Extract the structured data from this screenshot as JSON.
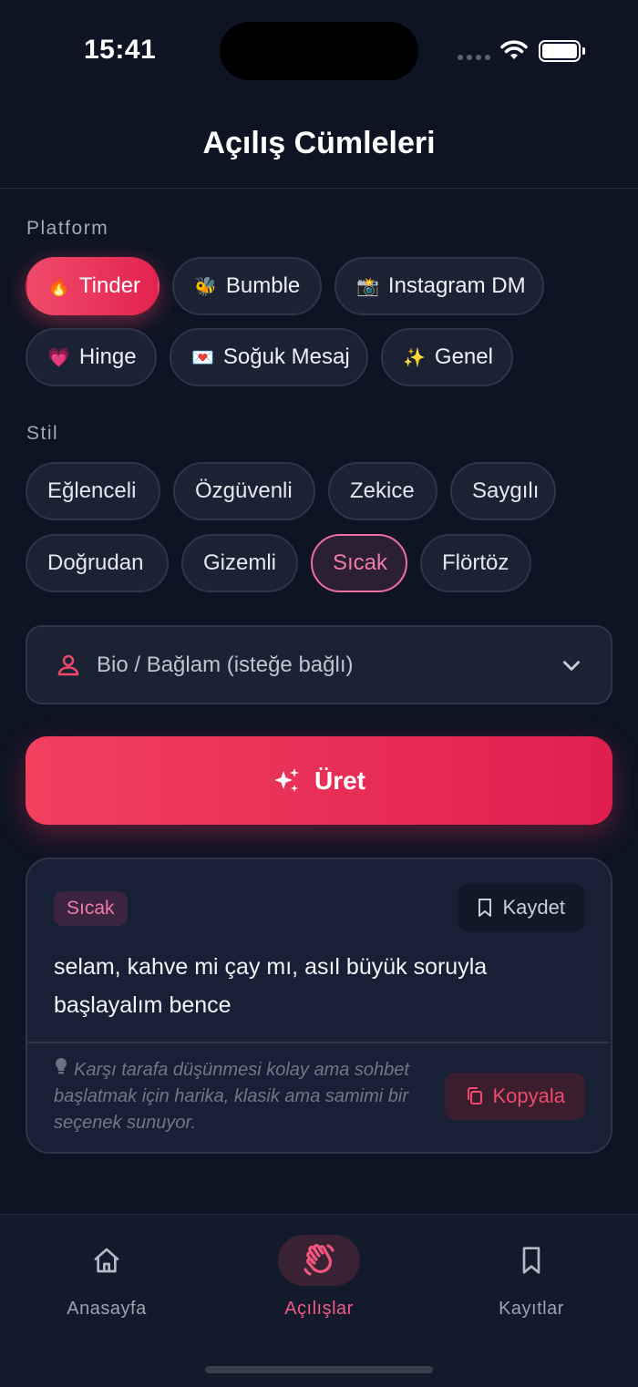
{
  "status_bar": {
    "time": "15:41"
  },
  "header": {
    "title": "Açılış Cümleleri"
  },
  "platform": {
    "label": "Platform",
    "chips": [
      {
        "emoji": "🔥",
        "label": "Tinder",
        "selected": true
      },
      {
        "emoji": "🐝",
        "label": "Bumble",
        "selected": false
      },
      {
        "emoji": "📸",
        "label": "Instagram DM",
        "selected": false
      },
      {
        "emoji": "💗",
        "label": "Hinge",
        "selected": false
      },
      {
        "emoji": "💌",
        "label": "Soğuk Mesaj",
        "selected": false
      },
      {
        "emoji": "✨",
        "label": "Genel",
        "selected": false
      }
    ]
  },
  "style": {
    "label": "Stil",
    "chips": [
      {
        "label": "Eğlenceli",
        "selected": false
      },
      {
        "label": "Özgüvenli",
        "selected": false
      },
      {
        "label": "Zekice",
        "selected": false
      },
      {
        "label": "Saygılı",
        "selected": false
      },
      {
        "label": "Doğrudan",
        "selected": false
      },
      {
        "label": "Gizemli",
        "selected": false
      },
      {
        "label": "Sıcak",
        "selected": true
      },
      {
        "label": "Flörtöz",
        "selected": false
      }
    ]
  },
  "bio": {
    "label": "Bio / Bağlam (isteğe bağlı)",
    "icon": "user-icon"
  },
  "generate": {
    "label": "Üret",
    "icon": "sparkles-icon"
  },
  "result": {
    "tag": "Sıcak",
    "save_label": "Kaydet",
    "text": "selam, kahve mi çay mı, asıl büyük soruyla başlayalım bence",
    "tip": "Karşı tarafa düşünmesi kolay ama sohbet başlatmak için harika, klasik ama samimi bir seçenek sunuyor.",
    "copy_label": "Kopyala"
  },
  "tabs": [
    {
      "label": "Anasayfa",
      "icon": "home-icon",
      "active": false
    },
    {
      "label": "Açılışlar",
      "icon": "wave-hand-icon",
      "active": true
    },
    {
      "label": "Kayıtlar",
      "icon": "bookmark-icon",
      "active": false
    }
  ],
  "colors": {
    "accent": "#e8284f",
    "pink": "#f27aa8",
    "background": "#0e1424"
  }
}
